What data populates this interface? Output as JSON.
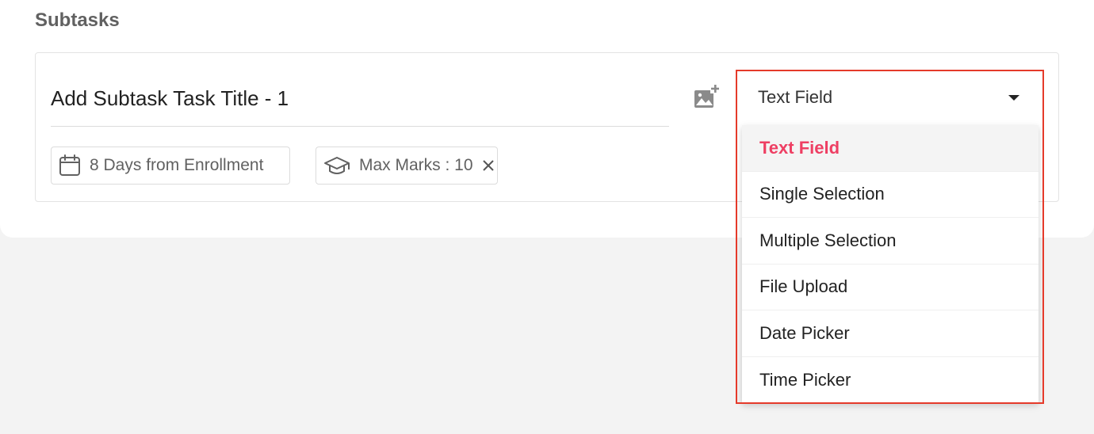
{
  "section": {
    "title": "Subtasks"
  },
  "subtask": {
    "title_value": "Add Subtask Task Title - 1",
    "duration_chip": "8 Days from Enrollment",
    "marks_chip": "Max Marks : 10"
  },
  "field_type": {
    "selected": "Text Field",
    "options": [
      "Text Field",
      "Single Selection",
      "Multiple Selection",
      "File Upload",
      "Date Picker",
      "Time Picker"
    ]
  },
  "colors": {
    "accent": "#ee3f63",
    "highlight_outline": "#e53a2a",
    "muted_text": "#616161"
  },
  "icons": [
    "add-image-icon",
    "calendar-icon",
    "graduation-cap-icon",
    "close-icon",
    "caret-down-icon"
  ]
}
